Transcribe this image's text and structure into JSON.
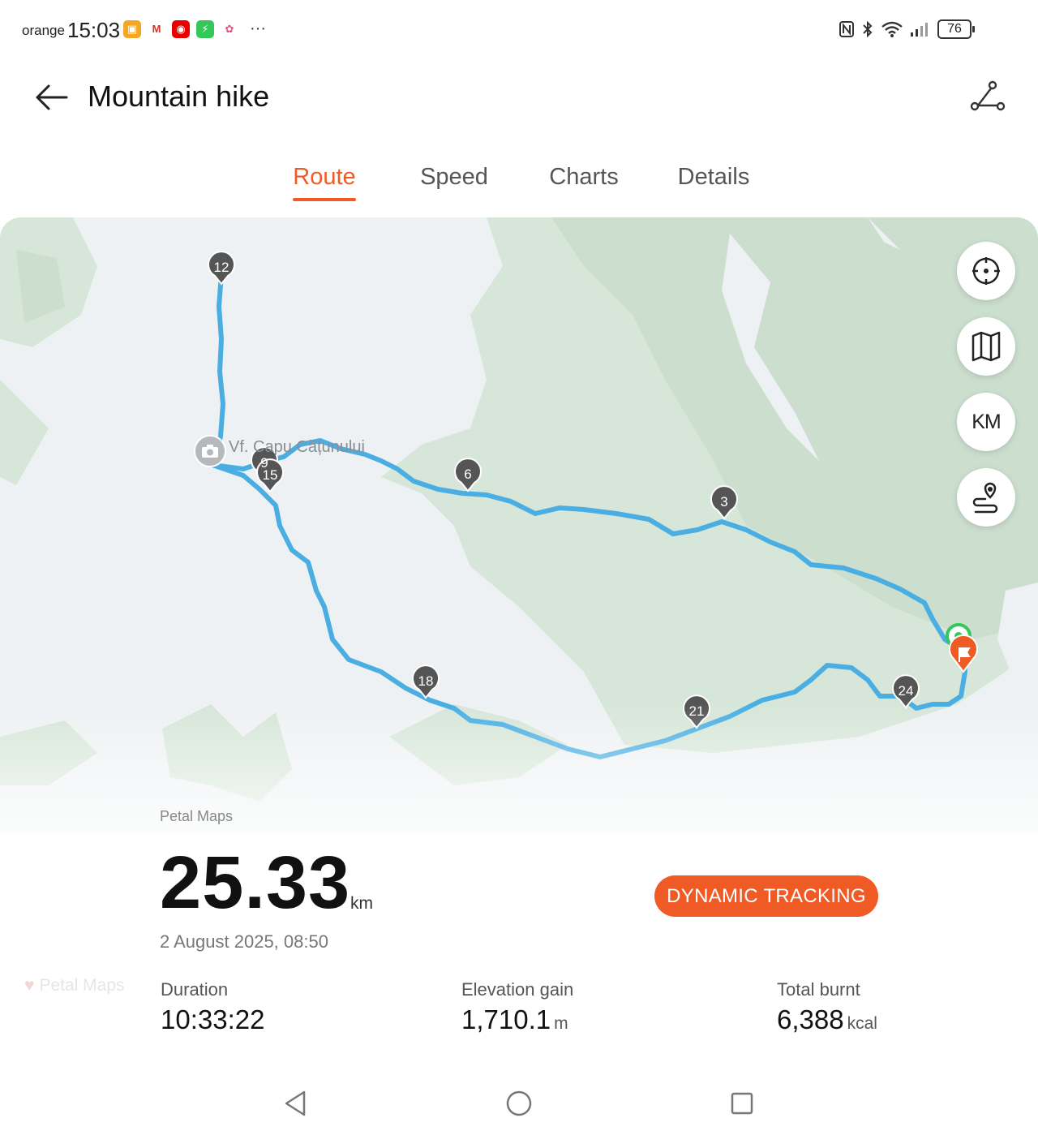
{
  "status_bar": {
    "carrier": "orange",
    "time": "15:03",
    "notifications": [
      {
        "icon": "wallet-app-icon",
        "color": "#f5a623"
      },
      {
        "icon": "gmail-icon",
        "color": "#ffffff"
      },
      {
        "icon": "vodafone-icon",
        "color": "#e60000"
      },
      {
        "icon": "charging-app-icon",
        "color": "#34c759"
      },
      {
        "icon": "photos-app-icon",
        "color": "#ffffff"
      }
    ],
    "more": "···",
    "battery": "76"
  },
  "header": {
    "title": "Mountain hike"
  },
  "tabs": [
    {
      "label": "Route",
      "active": true
    },
    {
      "label": "Speed",
      "active": false
    },
    {
      "label": "Charts",
      "active": false
    },
    {
      "label": "Details",
      "active": false
    }
  ],
  "map": {
    "poi_label": "Vf. Capu Cățunului",
    "route_color": "#4aaee3",
    "markers": [
      "12",
      "9",
      "15",
      "6",
      "3",
      "18",
      "21",
      "24"
    ],
    "start_color": "#34c759",
    "finish_color": "#f05a24",
    "buttons": [
      {
        "name": "locate-button",
        "icon": "crosshair-icon"
      },
      {
        "name": "map-layers-button",
        "icon": "map-icon"
      },
      {
        "name": "km-markers-button",
        "label": "KM"
      },
      {
        "name": "route-points-button",
        "icon": "route-pin-icon"
      }
    ],
    "provider": "Petal Maps",
    "watermark": "Petal Maps"
  },
  "summary": {
    "distance": "25.33",
    "distance_unit": "km",
    "datetime": "2 August 2025, 08:50",
    "dynamic_tracking_label": "DYNAMIC TRACKING",
    "accent": "#f05a24"
  },
  "stats": [
    {
      "label": "Duration",
      "value": "10:33:22",
      "unit": ""
    },
    {
      "label": "Elevation gain",
      "value": "1,710.1",
      "unit": "m"
    },
    {
      "label": "Total burnt",
      "value": "6,388",
      "unit": "kcal"
    }
  ]
}
